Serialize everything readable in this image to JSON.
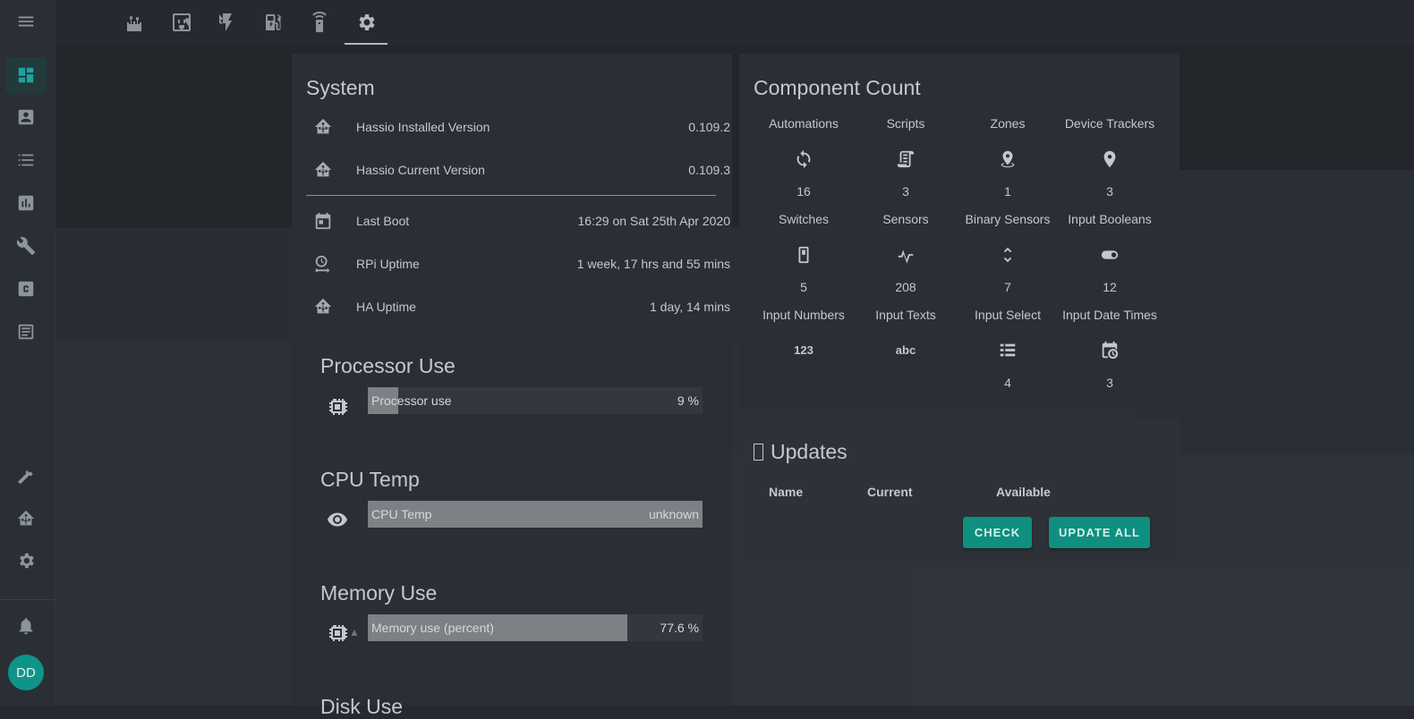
{
  "colors": {
    "accent": "#0f9488",
    "active_nav": "#1aa3a0",
    "button": "#0f8f7f"
  },
  "sidebar": {
    "items": [
      {
        "icon": "menu-icon"
      },
      {
        "icon": "dashboard-icon",
        "active": true
      },
      {
        "icon": "account-box-icon"
      },
      {
        "icon": "list-icon"
      },
      {
        "icon": "chart-icon"
      },
      {
        "icon": "wrench-icon"
      },
      {
        "icon": "c-box-icon"
      },
      {
        "icon": "log-icon"
      },
      {
        "icon": "hammer-icon"
      },
      {
        "icon": "home-assistant-icon"
      },
      {
        "icon": "gear-icon"
      },
      {
        "icon": "bell-icon"
      }
    ],
    "avatar_initials": "DD"
  },
  "tabs": [
    {
      "icon": "castle-icon"
    },
    {
      "icon": "power-socket-icon"
    },
    {
      "icon": "flash-icon"
    },
    {
      "icon": "ev-station-icon"
    },
    {
      "icon": "remote-icon"
    },
    {
      "icon": "settings-icon",
      "active": true
    }
  ],
  "system": {
    "title": "System",
    "rows": [
      {
        "icon": "home-assistant-icon",
        "label": "Hassio Installed Version",
        "value": "0.109.2"
      },
      {
        "icon": "home-assistant-icon",
        "label": "Hassio Current Version",
        "value": "0.109.3"
      },
      {
        "icon": "calendar-icon",
        "label": "Last Boot",
        "value": "16:29 on Sat 25th Apr 2020"
      },
      {
        "icon": "clock-uptime-icon",
        "label": "RPi Uptime",
        "value": "1 week, 17 hrs and 55 mins"
      },
      {
        "icon": "home-assistant-icon",
        "label": "HA Uptime",
        "value": "1 day, 14 mins"
      }
    ]
  },
  "processor": {
    "title": "Processor Use",
    "label": "Processor use",
    "value": "9 %",
    "fraction": 0.09
  },
  "cpu_temp": {
    "title": "CPU Temp",
    "label": "CPU Temp",
    "value": "unknown",
    "fraction": 1.0
  },
  "memory": {
    "title": "Memory Use",
    "label": "Memory use (percent)",
    "value": "77.6 %",
    "fraction": 0.776
  },
  "disk": {
    "title": "Disk Use"
  },
  "component_count": {
    "title": "Component Count",
    "items": [
      {
        "label": "Automations",
        "icon": "sync-icon",
        "count": "16"
      },
      {
        "label": "Scripts",
        "icon": "script-icon",
        "count": "3"
      },
      {
        "label": "Zones",
        "icon": "map-marker-radius-icon",
        "count": "1"
      },
      {
        "label": "Device Trackers",
        "icon": "map-marker-icon",
        "count": "3"
      },
      {
        "label": "Switches",
        "icon": "light-switch-icon",
        "count": "5"
      },
      {
        "label": "Sensors",
        "icon": "pulse-icon",
        "count": "208"
      },
      {
        "label": "Binary Sensors",
        "icon": "unfold-icon",
        "count": "7"
      },
      {
        "label": "Input Booleans",
        "icon": "toggle-icon",
        "count": "12"
      },
      {
        "label": "Input Numbers",
        "icon": "numeric-icon",
        "count": ""
      },
      {
        "label": "Input Texts",
        "icon": "alphabetical-icon",
        "count": ""
      },
      {
        "label": "Input Select",
        "icon": "format-list-icon",
        "count": "4"
      },
      {
        "label": "Input Date Times",
        "icon": "calendar-clock-icon",
        "count": "3"
      }
    ],
    "numeric_glyph": "123",
    "alpha_glyph": "abc"
  },
  "updates": {
    "title": "Updates",
    "headers": [
      "Name",
      "Current",
      "Available"
    ],
    "check_label": "CHECK",
    "update_all_label": "UPDATE ALL"
  }
}
